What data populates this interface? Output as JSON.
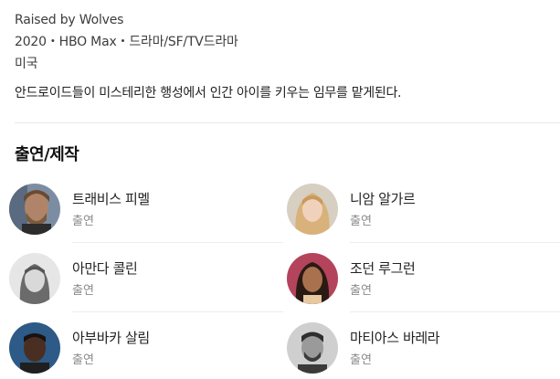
{
  "info": {
    "title": "Raised by Wolves",
    "meta": "2020・HBO Max・드라마/SF/TV드라마",
    "country": "미국",
    "synopsis": "안드로이드들이 미스테리한 행성에서 인간 아이를 키우는 임무를 맡게된다."
  },
  "cast_section": {
    "title": "출연/제작",
    "people": [
      {
        "name": "트래비스 피멜",
        "role": "출연",
        "avatar": "man-beard-long-hair-photo"
      },
      {
        "name": "니암 알가르",
        "role": "출연",
        "avatar": "woman-blonde-photo"
      },
      {
        "name": "아만다 콜린",
        "role": "출연",
        "avatar": "woman-pale-photo"
      },
      {
        "name": "조던 루그런",
        "role": "출연",
        "avatar": "woman-dark-hair-photo"
      },
      {
        "name": "아부바카 살림",
        "role": "출연",
        "avatar": "man-dark-skin-photo"
      },
      {
        "name": "마티아스 바레라",
        "role": "출연",
        "avatar": "man-short-hair-photo"
      }
    ]
  }
}
